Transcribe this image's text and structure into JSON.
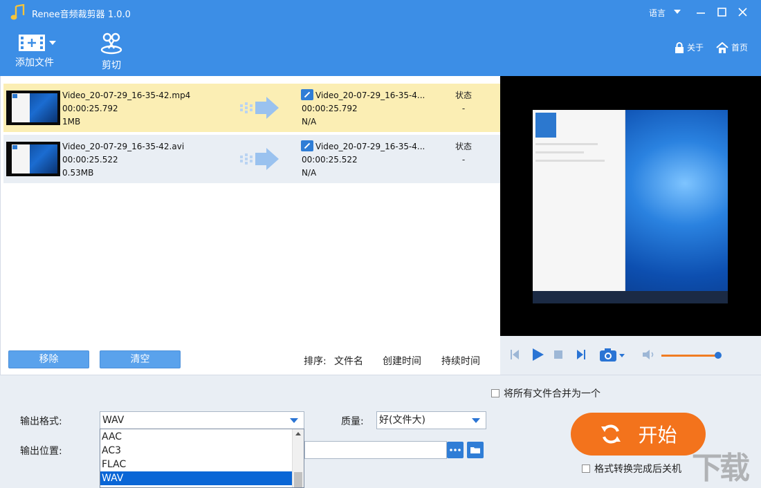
{
  "app": {
    "title": "Renee音频裁剪器 1.0.0",
    "language_label": "语言"
  },
  "toolbar": {
    "add_file_label": "添加文件",
    "cut_label": "剪切"
  },
  "header_links": {
    "about": "关于",
    "home": "首页"
  },
  "files": [
    {
      "name": "Video_20-07-29_16-35-42.mp4",
      "duration": "00:00:25.792",
      "size": "1MB",
      "output_name": "Video_20-07-29_16-35-4...",
      "output_duration": "00:00:25.792",
      "output_size": "N/A",
      "status_label": "状态",
      "status_value": "-"
    },
    {
      "name": "Video_20-07-29_16-35-42.avi",
      "duration": "00:00:25.522",
      "size": "0.53MB",
      "output_name": "Video_20-07-29_16-35-4...",
      "output_duration": "00:00:25.522",
      "output_size": "N/A",
      "status_label": "状态",
      "status_value": "-"
    }
  ],
  "list_actions": {
    "remove": "移除",
    "clear": "清空"
  },
  "sort": {
    "label": "排序:",
    "options": [
      "文件名",
      "创建时间",
      "持续时间"
    ]
  },
  "settings": {
    "merge_label": "将所有文件合并为一个",
    "format_label": "输出格式:",
    "format_value": "WAV",
    "format_options": [
      "AAC",
      "AC3",
      "FLAC",
      "WAV"
    ],
    "format_selected_index": 3,
    "quality_label": "质量:",
    "quality_value": "好(文件大)",
    "output_dir_label": "输出位置:",
    "output_dir_value": "",
    "start_label": "开始",
    "shutdown_label": "格式转换完成后关机"
  },
  "player": {
    "volume_fraction": 0.95
  },
  "watermark": "下载吧",
  "colors": {
    "header_blue": "#3c8ee6",
    "selected_row": "#fbeeb4",
    "start_orange": "#f3731c",
    "accent_blue": "#2a74d4"
  }
}
